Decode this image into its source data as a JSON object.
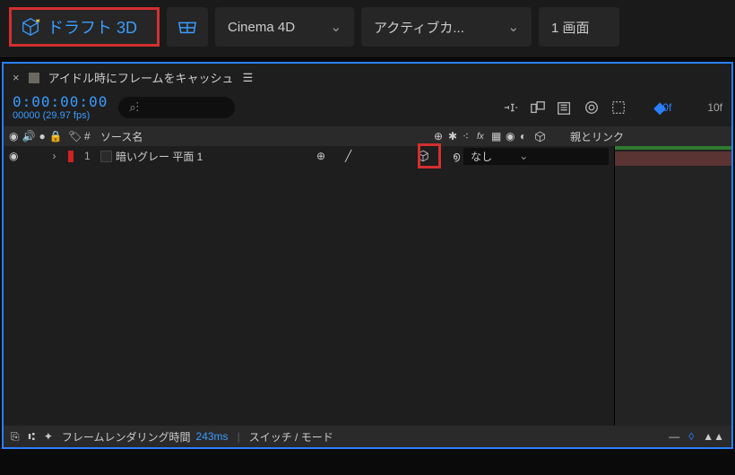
{
  "topbar": {
    "draft3d": "ドラフト 3D",
    "renderer": "Cinema 4D",
    "camera": "アクティブカ...",
    "views": "1 画面"
  },
  "panel": {
    "title": "アイドル時にフレームをキャッシュ",
    "timecode": "0:00:00:00",
    "fps": "00000 (29.97 fps)",
    "search_placeholder": ""
  },
  "ruler": {
    "t0": "0f",
    "t1": "10f"
  },
  "columns": {
    "num": "#",
    "source": "ソース名",
    "parent": "親とリンク"
  },
  "layer": {
    "num": "1",
    "name": "暗いグレー 平面 1",
    "parent_value": "なし"
  },
  "status": {
    "render_label": "フレームレンダリング時間",
    "render_ms": "243ms",
    "switch_mode": "スイッチ / モード"
  }
}
